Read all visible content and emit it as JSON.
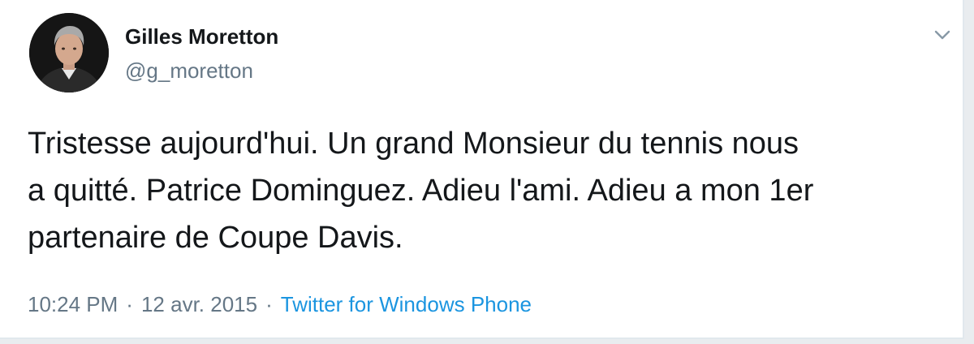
{
  "author": {
    "name": "Gilles Moretton",
    "handle": "@g_moretton"
  },
  "tweet": {
    "text": "Tristesse aujourd'hui. Un grand Monsieur du tennis nous\na quitté. Patrice Dominguez. Adieu l'ami. Adieu a mon 1er\npartenaire de Coupe Davis."
  },
  "meta": {
    "time": "10:24 PM",
    "separator": "·",
    "date": "12 avr. 2015",
    "source": "Twitter for Windows Phone"
  },
  "colors": {
    "name": "#14171a",
    "secondary": "#657786",
    "link": "#1b95e0"
  },
  "icons": {
    "menu": "chevron-down-icon"
  }
}
